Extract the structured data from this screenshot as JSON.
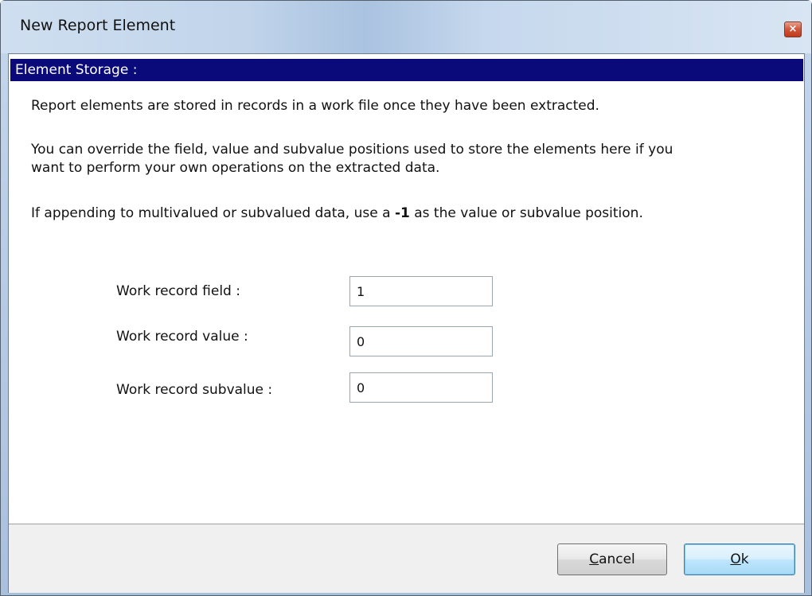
{
  "window": {
    "title": "New Report Element",
    "close_glyph": "×"
  },
  "section": {
    "header": "Element Storage :"
  },
  "paragraphs": {
    "p1": "Report elements are stored in records in a work file once they have been extracted.",
    "p2_line1": "You can override the field, value and subvalue positions used to store the elements here if you",
    "p2_line2": "want to perform your own operations on the extracted data.",
    "p3_before": "If appending to multivalued or subvalued data, use a ",
    "p3_bold": "-1",
    "p3_after": " as the value or subvalue position."
  },
  "fields": {
    "field_label": "Work record field :",
    "field_value": "1",
    "value_label": "Work record value :",
    "value_value": "0",
    "subvalue_label": "Work record subvalue :",
    "subvalue_value": "0"
  },
  "buttons": {
    "cancel_mnemonic": "C",
    "cancel_rest": "ancel",
    "ok_mnemonic": "O",
    "ok_rest": "k"
  },
  "colors": {
    "section_header_bg": "#0a0a7a",
    "close_button": "#c1391c"
  }
}
